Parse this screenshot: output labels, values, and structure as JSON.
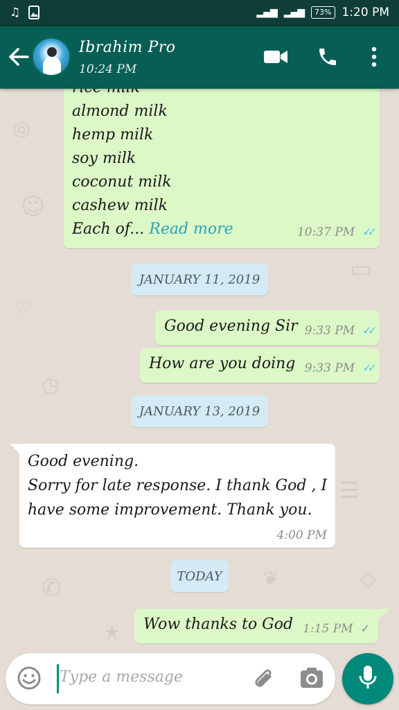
{
  "status_bar": {
    "battery": "73%",
    "time": "1:20 PM",
    "left_icons": [
      "music-note-icon",
      "image-notification-icon"
    ]
  },
  "header": {
    "contact_name": "Ibrahim Pro",
    "last_seen": "10:24 PM",
    "icons": [
      "back-arrow-icon",
      "video-call-icon",
      "voice-call-icon",
      "more-options-icon"
    ]
  },
  "messages": {
    "m1": {
      "lines": [
        "rice milk",
        "almond milk",
        "hemp milk",
        "soy milk",
        "coconut milk",
        "cashew milk"
      ],
      "truncated": "Each of...",
      "read_more": "Read more",
      "time": "10:37 PM",
      "ticks": "✓✓"
    },
    "date1": "JANUARY 11, 2019",
    "m2": {
      "text": "Good evening Sir",
      "time": "9:33 PM",
      "ticks": "✓✓"
    },
    "m3": {
      "text": "How are you doing",
      "time": "9:33 PM",
      "ticks": "✓✓"
    },
    "date2": "JANUARY 13, 2019",
    "m4": {
      "line1": "Good evening.",
      "line2": "Sorry for late response. I thank God , I",
      "line3": "have some improvement. Thank you.",
      "time": "4:00 PM"
    },
    "date3": "TODAY",
    "m5": {
      "text": "Wow thanks to God",
      "time": "1:15 PM",
      "ticks": "✓"
    }
  },
  "input": {
    "placeholder": "Type a message",
    "icons": [
      "emoji-icon",
      "attachment-icon",
      "camera-icon",
      "microphone-icon"
    ]
  },
  "colors": {
    "header": "#075e54",
    "status_bar": "#0f3d37",
    "outgoing_bubble": "#dcf8c6",
    "incoming_bubble": "#ffffff",
    "date_chip": "#d4eaf4",
    "accent": "#00897b",
    "read_ticks": "#4fc3f7",
    "link": "#2aa3b8"
  }
}
